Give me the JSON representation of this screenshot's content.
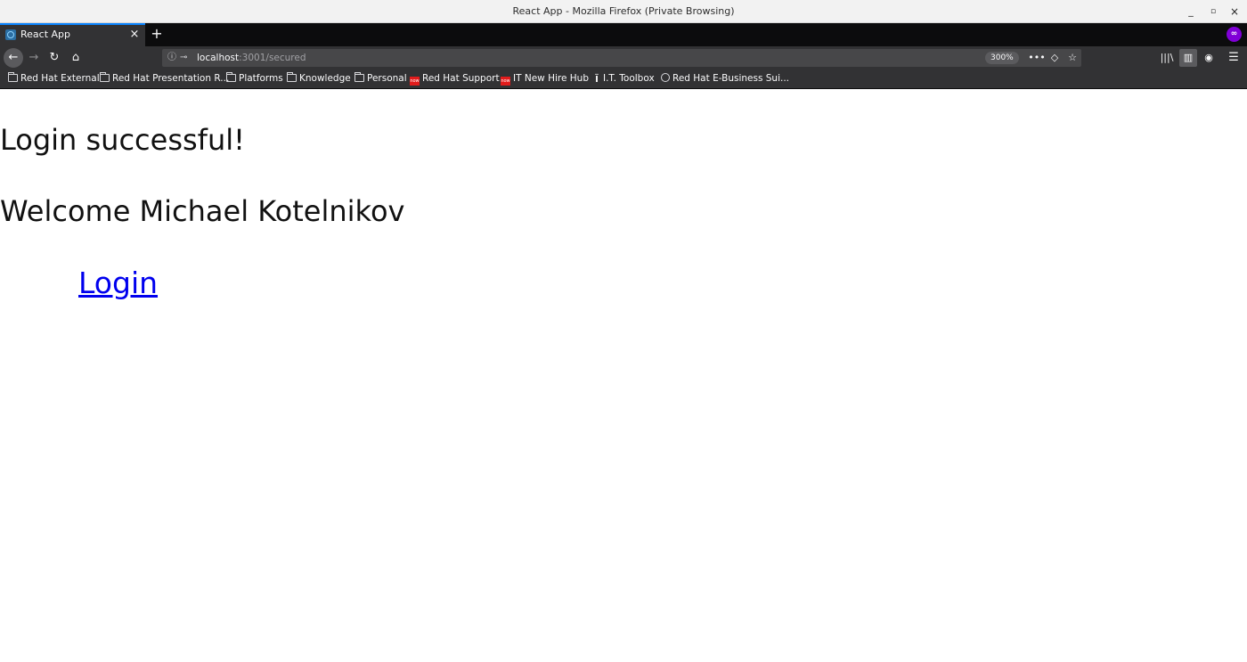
{
  "window": {
    "title": "React App - Mozilla Firefox (Private Browsing)",
    "minimize": "_",
    "maximize": "▫",
    "close": "×"
  },
  "tabs": [
    {
      "label": "React App",
      "close": "×",
      "favicon": "react-favicon-icon"
    }
  ],
  "tabstrip": {
    "new_tab": "+",
    "private_icon": "∞"
  },
  "toolbar": {
    "back": "←",
    "forward": "→",
    "reload": "↻",
    "home": "⌂",
    "url_host": "localhost",
    "url_path": ":3001/secured",
    "zoom": "300%",
    "page_actions_more": "•••",
    "pocket": "◇",
    "bookmark_star": "☆",
    "library": "|||\\",
    "sidebar": "▥",
    "account": "◉",
    "menu": "☰"
  },
  "bookmarks": [
    {
      "label": "Red Hat External",
      "icon": "folder-icon"
    },
    {
      "label": "Red Hat Presentation R...",
      "icon": "folder-icon"
    },
    {
      "label": "Platforms",
      "icon": "folder-icon"
    },
    {
      "label": "Knowledge",
      "icon": "folder-icon"
    },
    {
      "label": "Personal",
      "icon": "folder-icon"
    },
    {
      "label": "Red Hat Support",
      "icon": "now-icon"
    },
    {
      "label": "IT New Hire Hub",
      "icon": "now-icon"
    },
    {
      "label": "I.T. Toolbox",
      "icon": "it-icon"
    },
    {
      "label": "Red Hat E-Business Sui...",
      "icon": "globe-icon"
    }
  ],
  "page": {
    "heading": "Login successful!",
    "welcome": "Welcome Michael Kotelnikov",
    "link_label": "Login"
  }
}
